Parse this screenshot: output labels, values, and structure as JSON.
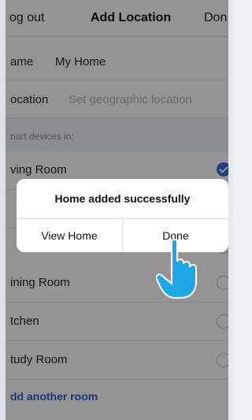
{
  "nav": {
    "left": "og out",
    "title": "Add Location",
    "right": "Don"
  },
  "form": {
    "name_label": "ame",
    "name_value": "My Home",
    "location_label": "ocation",
    "location_placeholder": "Set geographic location"
  },
  "section": {
    "title": "nart devices in:"
  },
  "rooms": [
    {
      "label": "ving Room",
      "checked": true
    },
    {
      "label": "",
      "checked": false
    },
    {
      "label": "ining Room",
      "checked": false
    },
    {
      "label": "tchen",
      "checked": false
    },
    {
      "label": "tudy Room",
      "checked": false
    }
  ],
  "add_room": "dd another room",
  "dialog": {
    "message": "Home added successfully",
    "view_label": "View Home",
    "done_label": "Done"
  },
  "colors": {
    "accent": "#3b6fd8",
    "link": "#2f5fcf",
    "hand": "#1ea7e4"
  }
}
